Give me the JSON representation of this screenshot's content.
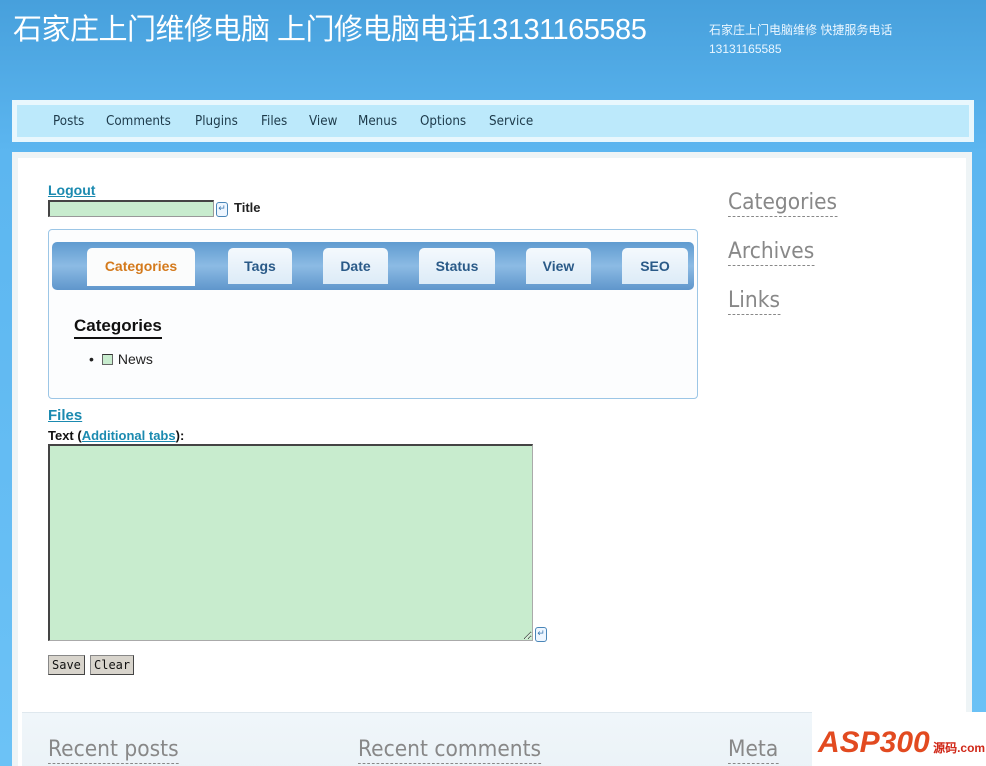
{
  "header": {
    "title": "石家庄上门维修电脑 上门修电脑电话13131165585",
    "tagline": "石家庄上门电脑维修 快捷服务电话13131165585"
  },
  "nav": {
    "items": [
      "Posts",
      "Comments",
      "Plugins",
      "Files",
      "View",
      "Menus",
      "Options",
      "Service"
    ]
  },
  "editor": {
    "logout": "Logout",
    "title_label": "Title",
    "title_value": "",
    "tabs": [
      {
        "label": "Categories",
        "active": true
      },
      {
        "label": "Tags"
      },
      {
        "label": "Date"
      },
      {
        "label": "Status"
      },
      {
        "label": "View"
      },
      {
        "label": "SEO"
      }
    ],
    "categories_heading": "Categories",
    "categories": [
      {
        "label": "News",
        "checked": false
      }
    ],
    "files_link": "Files",
    "text_label": "Text (",
    "text_link": "Additional tabs",
    "text_suffix": "):",
    "text_value": "",
    "save": "Save",
    "clear": "Clear"
  },
  "sidebar": {
    "items": [
      "Categories",
      "Archives",
      "Links"
    ]
  },
  "footer": {
    "items": [
      "Recent posts",
      "Recent comments",
      "Meta"
    ]
  },
  "logo": {
    "text": "ASP300",
    "sub": "源码 .com"
  },
  "colors": {
    "link": "#1b8ab0",
    "active_tab": "#d47a1c",
    "input_bg": "#c8ecce",
    "nav_bg": "#bce9fb"
  }
}
